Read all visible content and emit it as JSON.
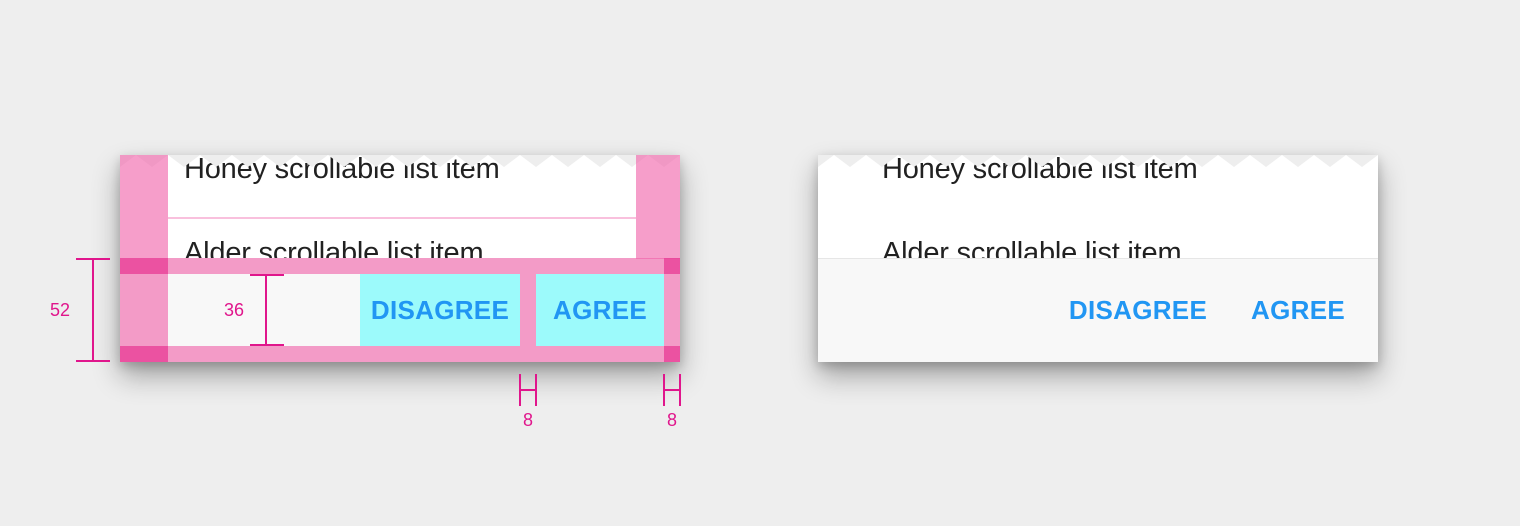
{
  "list_items": [
    "Honey scrollable list item",
    "Alder scrollable list item"
  ],
  "actions": {
    "disagree": "DISAGREE",
    "agree": "AGREE"
  },
  "measurements": {
    "bar_height": "52",
    "button_height": "36",
    "button_gap": "8",
    "right_padding": "8"
  },
  "colors": {
    "accent": "#2196f3",
    "spec_magenta": "#e0168c",
    "overlay_pink": "#f062aa",
    "overlay_cyan": "#8cfafc"
  }
}
